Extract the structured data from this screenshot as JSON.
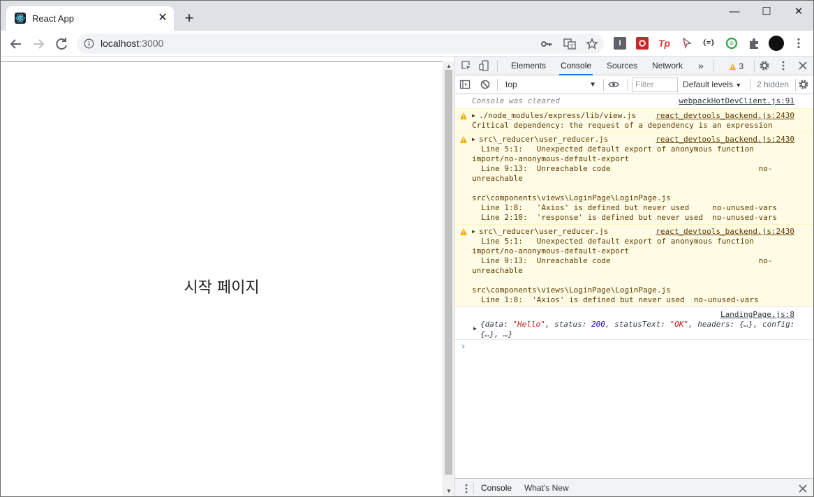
{
  "browser": {
    "tab_title": "React App",
    "close_tab_glyph": "✕",
    "new_tab_glyph": "+",
    "window_controls": {
      "minimize": "—",
      "maximize": "☐",
      "close": "✕"
    },
    "url_host": "localhost",
    "url_port": ":3000",
    "extension_icons": [
      "key-icon",
      "translate-icon",
      "star-icon",
      "i-extension-icon",
      "red-extension-icon",
      "tp-extension-icon",
      "cursor-extension-icon",
      "json-extension-icon",
      "green-ring-extension-icon",
      "puzzle-icon",
      "profile-avatar",
      "more-menu-icon"
    ],
    "tp_label": "Tp",
    "i_label": "I",
    "json_label": "{=}"
  },
  "page": {
    "heading": "시작 페이지"
  },
  "devtools": {
    "tabs": [
      "Elements",
      "Console",
      "Sources",
      "Network"
    ],
    "active_tab": "Console",
    "more_tabs_glyph": "»",
    "warning_count": "3",
    "context": "top",
    "filter_placeholder": "Filter",
    "levels": "Default levels",
    "hidden": "2 hidden",
    "console": {
      "cleared": {
        "text": "Console was cleared",
        "source": "webpackHotDevClient.js:91"
      },
      "warn1": {
        "title": "./node_modules/express/lib/view.js",
        "source": "react_devtools_backend.js:2430",
        "lines": [
          "Critical dependency: the request of a dependency is an expression"
        ]
      },
      "warn2": {
        "title": "src\\_reducer\\user_reducer.js",
        "source": "react_devtools_backend.js:2430",
        "lines": [
          "  Line 5:1:   Unexpected default export of anonymous function",
          "import/no-anonymous-default-export",
          "  Line 9:13:  Unreachable code                                no-",
          "unreachable",
          "",
          "src\\components\\views\\LoginPage\\LoginPage.js",
          "  Line 1:8:   'Axios' is defined but never used     no-unused-vars",
          "  Line 2:10:  'response' is defined but never used  no-unused-vars"
        ]
      },
      "warn3": {
        "title": "src\\_reducer\\user_reducer.js",
        "source": "react_devtools_backend.js:2430",
        "lines": [
          "  Line 5:1:   Unexpected default export of anonymous function",
          "import/no-anonymous-default-export",
          "  Line 9:13:  Unreachable code                                no-",
          "unreachable",
          "",
          "src\\components\\views\\LoginPage\\LoginPage.js",
          "  Line 1:8:  'Axios' is defined but never used  no-unused-vars"
        ]
      },
      "log": {
        "source": "LandingPage.js:8",
        "open": "{data: ",
        "data": "\"Hello\"",
        "status_key": ", status: ",
        "status": "200",
        "statustext_key": ", statusText: ",
        "statustext": "\"OK\"",
        "rest": ", headers: {…}, config:",
        "line2": "{…}, …}"
      },
      "prompt": "›"
    },
    "drawer": {
      "tabs": [
        "Console",
        "What's New"
      ],
      "active": "Console"
    }
  }
}
